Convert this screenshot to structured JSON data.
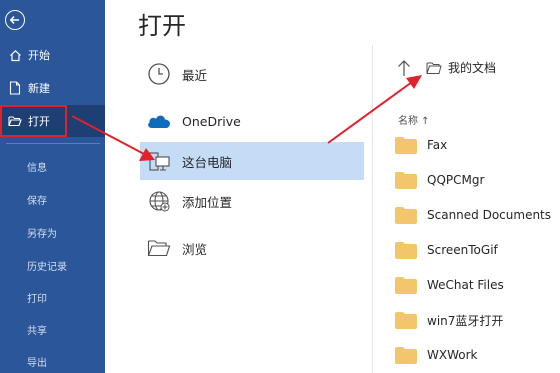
{
  "sidebar": {
    "back_icon": "back-arrow-icon",
    "items": [
      {
        "label": "开始",
        "icon": "home-icon"
      },
      {
        "label": "新建",
        "icon": "new-document-icon"
      },
      {
        "label": "打开",
        "icon": "open-folder-icon",
        "selected": true
      }
    ],
    "sub_items": [
      "信息",
      "保存",
      "另存为",
      "历史记录",
      "打印",
      "共享",
      "导出"
    ],
    "background": "#2b579a",
    "highlight_color": "#e0222a"
  },
  "main": {
    "title": "打开",
    "locations": [
      {
        "label": "最近",
        "icon": "clock-icon"
      },
      {
        "label": "OneDrive",
        "icon": "onedrive-cloud-icon"
      },
      {
        "label": "这台电脑",
        "icon": "computer-icon",
        "selected": true
      },
      {
        "label": "添加位置",
        "icon": "add-location-icon"
      },
      {
        "label": "浏览",
        "icon": "browse-folder-icon"
      }
    ]
  },
  "files": {
    "current_folder": "我的文档",
    "column_header": "名称 ↑",
    "folders": [
      "Fax",
      "QQPCMgr",
      "Scanned Documents",
      "ScreenToGif",
      "WeChat Files",
      "win7蓝牙打开",
      "WXWork"
    ],
    "folder_color": "#f3c66b"
  }
}
